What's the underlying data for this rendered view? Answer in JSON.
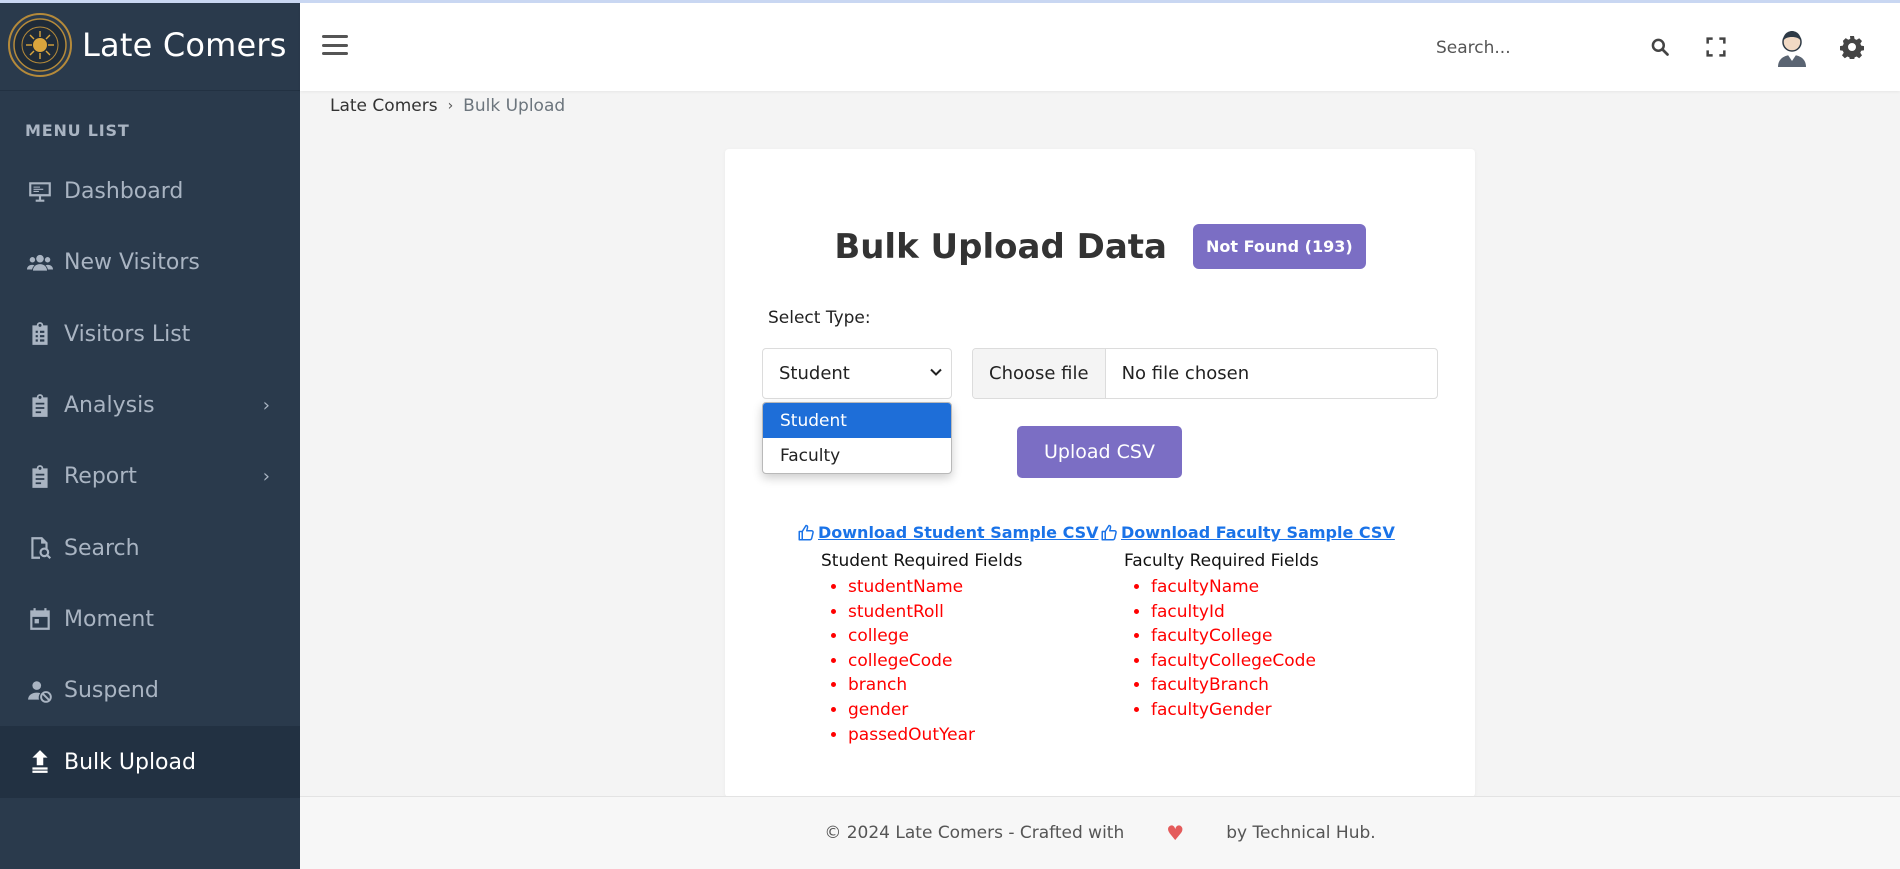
{
  "app": {
    "brand": "Late Comers"
  },
  "sidebar": {
    "menu_label": "MENU LIST",
    "items": [
      {
        "label": "Dashboard",
        "icon": "monitor-icon"
      },
      {
        "label": "New Visitors",
        "icon": "users-icon"
      },
      {
        "label": "Visitors List",
        "icon": "clipboard-list-icon"
      },
      {
        "label": "Analysis",
        "icon": "clipboard-icon",
        "has_submenu": true
      },
      {
        "label": "Report",
        "icon": "clipboard-icon",
        "has_submenu": true
      },
      {
        "label": "Search",
        "icon": "search-file-icon"
      },
      {
        "label": "Moment",
        "icon": "calendar-icon"
      },
      {
        "label": "Suspend",
        "icon": "user-slash-icon"
      },
      {
        "label": "Bulk Upload",
        "icon": "upload-icon",
        "active": true
      }
    ]
  },
  "header": {
    "search_placeholder": "Search..."
  },
  "breadcrumb": {
    "root": "Late Comers",
    "current": "Bulk Upload"
  },
  "card": {
    "title": "Bulk Upload Data",
    "badge": "Not Found (193)",
    "select_label": "Select Type:",
    "select_value": "Student",
    "select_options": [
      "Student",
      "Faculty"
    ],
    "choose_file_label": "Choose file",
    "file_status": "No file chosen",
    "upload_button": "Upload CSV",
    "student": {
      "download_link": "Download Student Sample CSV",
      "required_title": "Student Required Fields",
      "fields": [
        "studentName",
        "studentRoll",
        "college",
        "collegeCode",
        "branch",
        "gender",
        "passedOutYear"
      ]
    },
    "faculty": {
      "download_link": "Download Faculty Sample CSV",
      "required_title": "Faculty Required Fields",
      "fields": [
        "facultyName",
        "facultyId",
        "facultyCollege",
        "facultyCollegeCode",
        "facultyBranch",
        "facultyGender"
      ]
    }
  },
  "footer": {
    "left": "© 2024 Late Comers - Crafted with",
    "right": "by Technical Hub."
  },
  "colors": {
    "sidebar": "#2a3a4c",
    "accent": "#7b6ec4",
    "link": "#1a73e8",
    "required": "#ff0000"
  }
}
